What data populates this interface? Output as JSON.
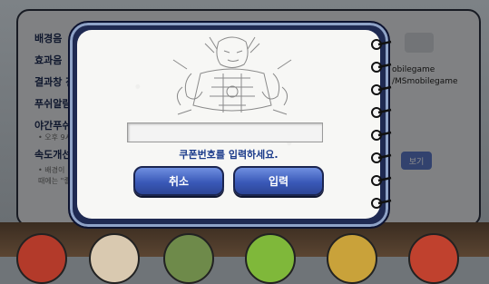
{
  "settings": {
    "items": [
      {
        "label": "배경음"
      },
      {
        "label": "효과음"
      },
      {
        "label": "결과창 전"
      },
      {
        "label": "푸쉬알림"
      },
      {
        "label": "야간푸쉬"
      },
      {
        "label": "속도개선"
      }
    ],
    "sub_notes": [
      "• 오후 9시",
      "• 배경이",
      "때에는 \"좋"
    ],
    "right_texts": [
      "obilegame",
      "/MSmobilegame"
    ],
    "right_button_label": "보기"
  },
  "dialog": {
    "coupon_input": {
      "value": "",
      "placeholder": ""
    },
    "hint": "쿠폰번호를 입력하세요.",
    "cancel_label": "취소",
    "submit_label": "입력"
  },
  "colors": {
    "dialog_frame": "#1f2a52",
    "button_blue": "#3a59b8",
    "hint_text": "#1a3a8a"
  },
  "icons": [
    "spiral-ring-icon",
    "character-sketch-illustration"
  ]
}
